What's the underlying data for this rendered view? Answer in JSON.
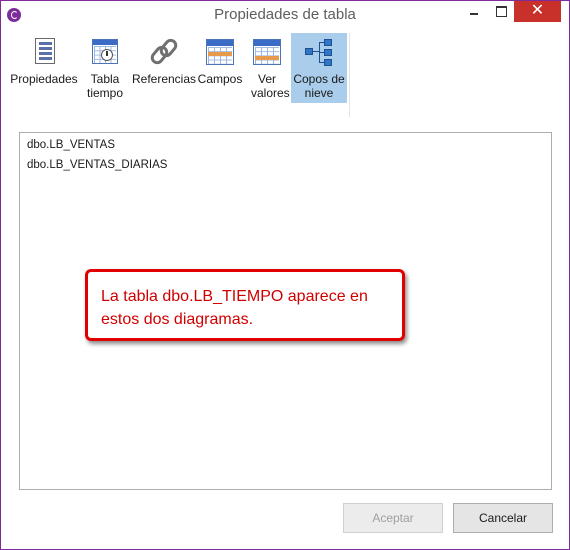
{
  "window": {
    "title": "Propiedades de tabla",
    "close_glyph": "✕",
    "accent_color": "#7d2c9c",
    "close_color": "#c7312a"
  },
  "toolbar": {
    "items": [
      {
        "label": "Propiedades",
        "icon": "properties-icon",
        "active": false
      },
      {
        "label": "Tabla tiempo",
        "icon": "time-table-icon",
        "active": false
      },
      {
        "label": "Referencias",
        "icon": "chain-link-icon",
        "active": false
      },
      {
        "label": "Campos",
        "icon": "fields-table-icon",
        "active": false
      },
      {
        "label": "Ver valores",
        "icon": "values-table-icon",
        "active": false
      },
      {
        "label": "Copos de nieve",
        "icon": "snowflake-schema-icon",
        "active": true
      }
    ]
  },
  "list": {
    "items": [
      "dbo.LB_VENTAS",
      "dbo.LB_VENTAS_DIARIAS"
    ]
  },
  "callout": {
    "text": "La tabla dbo.LB_TIEMPO aparece en estos dos diagramas.",
    "color": "#e00000"
  },
  "buttons": {
    "accept": "Aceptar",
    "cancel": "Cancelar"
  }
}
